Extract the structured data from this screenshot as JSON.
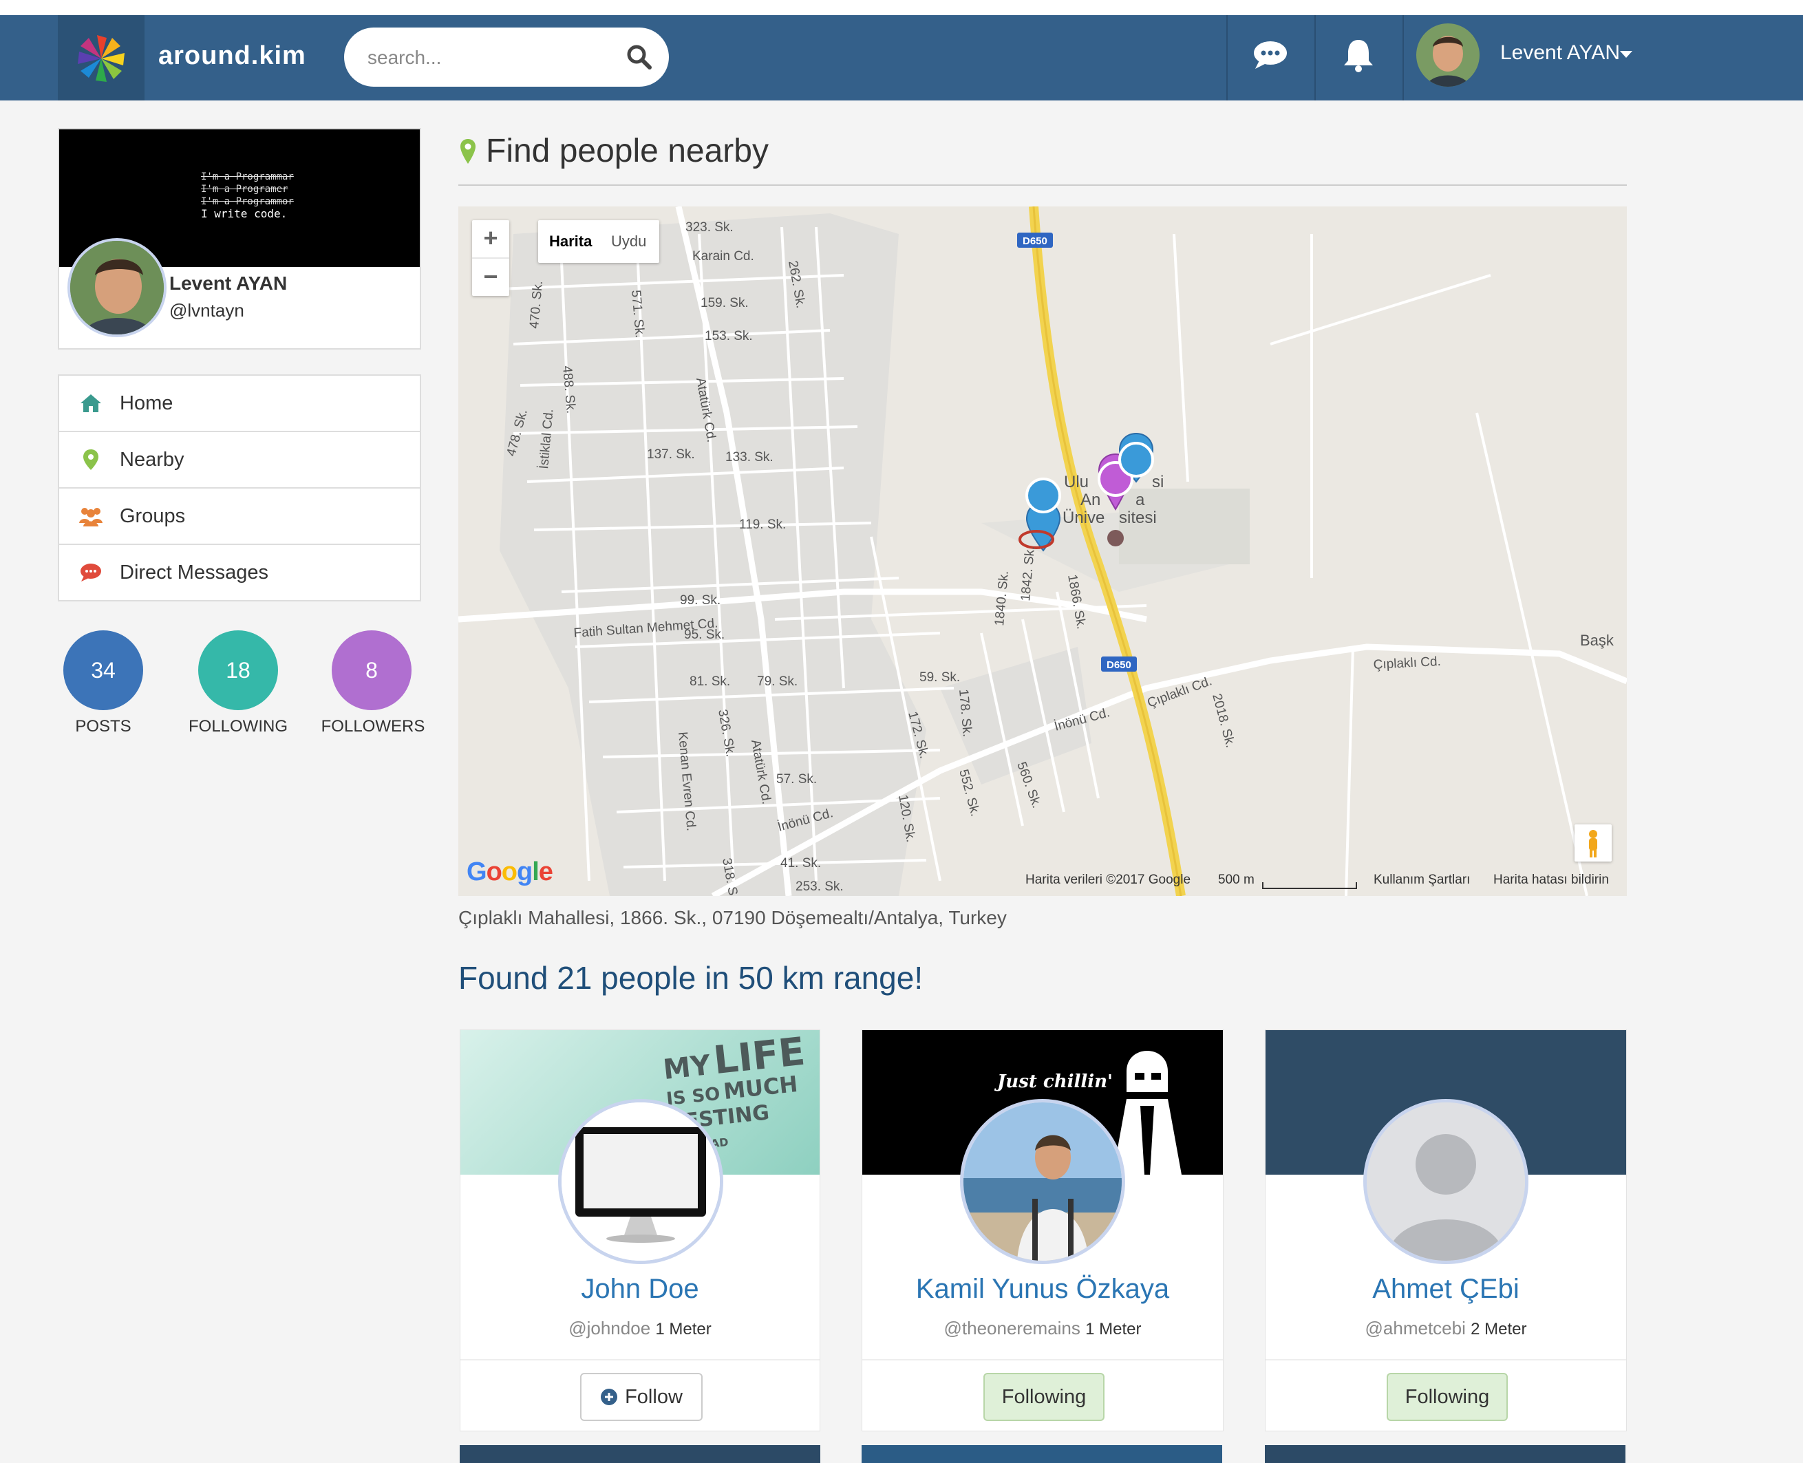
{
  "app": {
    "brand": "around.kim",
    "search_placeholder": "search...",
    "user_name": "Levent AYAN"
  },
  "profile": {
    "name": "Levent AYAN",
    "handle": "@lvntayn",
    "cover_lines": [
      "I'm a Programmar",
      "I'm a Programer",
      "I'm a Programmor",
      "I write code."
    ]
  },
  "menu": [
    {
      "label": "Home",
      "icon": "home-icon"
    },
    {
      "label": "Nearby",
      "icon": "map-pin-icon"
    },
    {
      "label": "Groups",
      "icon": "users-icon"
    },
    {
      "label": "Direct Messages",
      "icon": "comment-icon"
    }
  ],
  "stats": [
    {
      "value": "34",
      "label": "POSTS",
      "color": "#3c74b8"
    },
    {
      "value": "18",
      "label": "FOLLOWING",
      "color": "#35b8a9"
    },
    {
      "value": "8",
      "label": "FOLLOWERS",
      "color": "#b06fd0"
    }
  ],
  "page": {
    "title": "Find people nearby",
    "address": "Çıplaklı Mahallesi, 1866. Sk., 07190 Döşemealtı/Antalya, Turkey",
    "found": "Found 21 people in 50 km range!"
  },
  "map": {
    "zoom_in": "+",
    "zoom_out": "−",
    "type_map": "Harita",
    "type_satellite": "Uydu",
    "footer_data": "Harita verileri ©2017 Google",
    "footer_scale": "500 m",
    "footer_terms": "Kullanım Şartları",
    "footer_report": "Harita hatası bildirin",
    "labels": [
      "323. Sk.",
      "Karain Cd.",
      "262. Sk.",
      "159. Sk.",
      "153. Sk.",
      "571. Sk.",
      "470. Sk.",
      "488. Sk.",
      "Atatürk Cd.",
      "478. Sk.",
      "İstiklal Cd.",
      "137. Sk.",
      "133. Sk.",
      "119. Sk.",
      "99. Sk.",
      "Fatih Sultan Mehmet Cd.",
      "95. Sk.",
      "81. Sk.",
      "79. Sk.",
      "326. Sk.",
      "Kenan Evren Cd.",
      "Atatürk Cd.",
      "57. Sk.",
      "İnönü Cd.",
      "41. Sk.",
      "253. Sk.",
      "318. S",
      "172. Sk.",
      "120. Sk.",
      "178. Sk.",
      "552. Sk.",
      "59. Sk.",
      "560. Sk.",
      "İnönü Cd.",
      "Çıplaklı Cd.",
      "2018. Sk.",
      "Çıplaklı Cd.",
      "Başk",
      "1840. Sk.",
      "1842. Sk.",
      "1866. Sk.",
      "Ulu",
      "si",
      "An",
      "a",
      "Ünive",
      "sitesi",
      "D650",
      "D650"
    ]
  },
  "people": [
    {
      "name": "John Doe",
      "handle": "@johndoe",
      "distance": "1 Meter",
      "button": "Follow",
      "state": "follow"
    },
    {
      "name": "Kamil Yunus Özkaya",
      "handle": "@theoneremains",
      "distance": "1 Meter",
      "button": "Following",
      "state": "following",
      "cover_text": "Just chillin'"
    },
    {
      "name": "Ahmet ÇEbi",
      "handle": "@ahmetcebi",
      "distance": "2 Meter",
      "button": "Following",
      "state": "following"
    }
  ],
  "john_cover_words": [
    "MY",
    "LIFE",
    "IS SO",
    "MUCH",
    "RESTING",
    "MY HEAD"
  ],
  "colors": {
    "navbar": "#34608a",
    "link": "#2a75b3",
    "found": "#1f4e79"
  }
}
